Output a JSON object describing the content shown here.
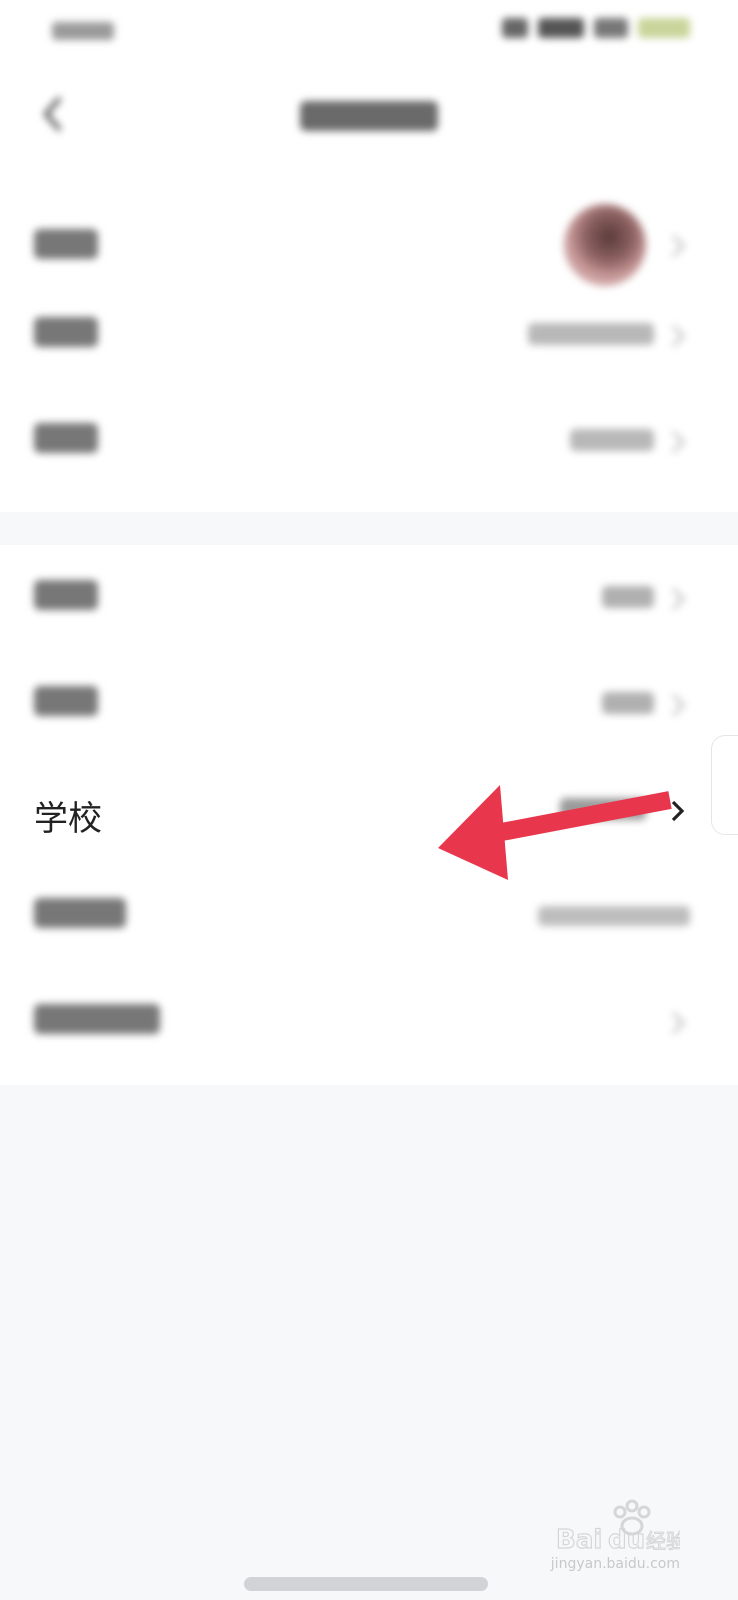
{
  "nav": {
    "title": ""
  },
  "rows": [
    {
      "name": "avatar",
      "label": "",
      "value": ""
    },
    {
      "name": "nickname",
      "label": "",
      "value": ""
    },
    {
      "name": "gender",
      "label": "",
      "value": ""
    },
    {
      "name": "identity",
      "label": "",
      "value": ""
    },
    {
      "name": "grade",
      "label": "",
      "value": ""
    },
    {
      "name": "school",
      "label": "学校",
      "value": ""
    },
    {
      "name": "bound-phone",
      "label": "",
      "value": ""
    },
    {
      "name": "change-password",
      "label": "",
      "value": ""
    }
  ],
  "annotation": {
    "arrow_color": "#e8364d"
  },
  "watermark": {
    "text": "jingyan.baidu.com"
  },
  "colors": {
    "background": "#f7f8fa",
    "surface": "#ffffff",
    "text_primary": "#222222",
    "text_secondary": "#888888"
  }
}
